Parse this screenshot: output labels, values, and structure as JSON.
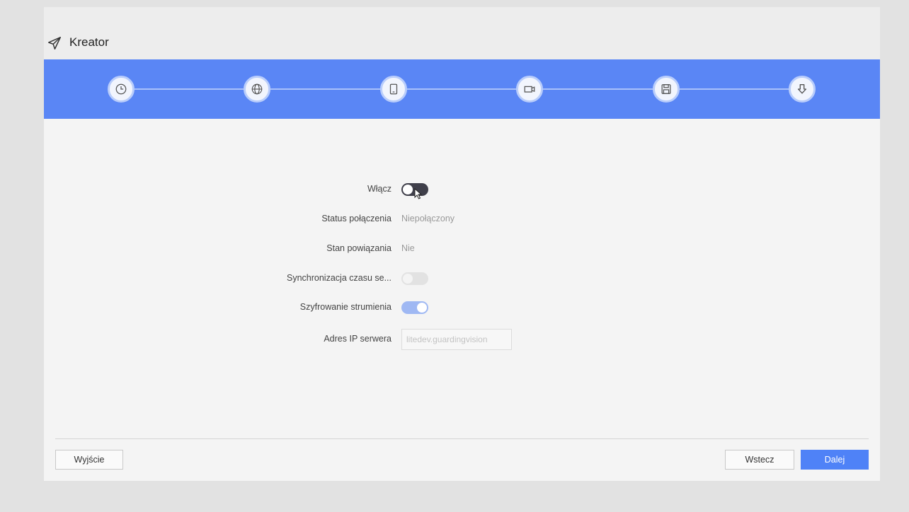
{
  "window": {
    "title": "Kreator"
  },
  "steps": [
    {
      "name": "time",
      "icon": "clock-icon"
    },
    {
      "name": "network",
      "icon": "globe-icon"
    },
    {
      "name": "platform",
      "icon": "mobile-icon"
    },
    {
      "name": "camera",
      "icon": "camera-icon"
    },
    {
      "name": "storage",
      "icon": "save-icon"
    },
    {
      "name": "download",
      "icon": "download-icon"
    }
  ],
  "form": {
    "enable": {
      "label": "Włącz",
      "state": "off"
    },
    "connection_status": {
      "label": "Status połączenia",
      "value": "Niepołączony"
    },
    "binding_state": {
      "label": "Stan powiązania",
      "value": "Nie"
    },
    "time_sync": {
      "label": "Synchronizacja czasu se...",
      "state": "off-disabled"
    },
    "stream_encryption": {
      "label": "Szyfrowanie strumienia",
      "state": "on"
    },
    "server_ip": {
      "label": "Adres IP serwera",
      "placeholder": "litedev.guardingvision"
    }
  },
  "buttons": {
    "exit": "Wyjście",
    "back": "Wstecz",
    "next": "Dalej"
  },
  "colors": {
    "accent": "#5a86f5",
    "primary_button": "#4f82f7"
  }
}
